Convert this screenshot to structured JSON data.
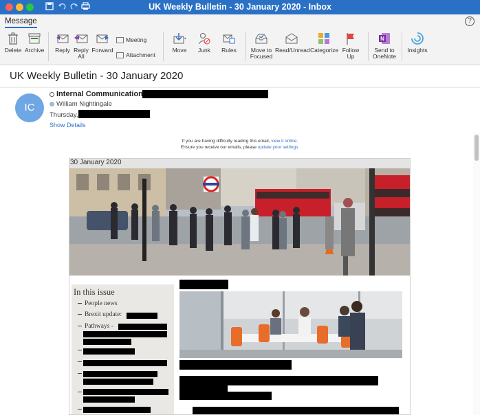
{
  "window": {
    "title": "UK Weekly Bulletin - 30 January 2020 - Inbox"
  },
  "tabs": {
    "message": "Message"
  },
  "ribbon": {
    "delete": "Delete",
    "archive": "Archive",
    "reply": "Reply",
    "reply_all_1": "Reply",
    "reply_all_2": "All",
    "forward": "Forward",
    "meeting": "Meeting",
    "attachment": "Attachment",
    "move": "Move",
    "junk": "Junk",
    "rules": "Rules",
    "move_focused_1": "Move to",
    "move_focused_2": "Focused",
    "read_unread": "Read/Unread",
    "categorize": "Categorize",
    "follow_up_1": "Follow",
    "follow_up_2": "Up",
    "onenote_1": "Send to",
    "onenote_2": "OneNote",
    "insights": "Insights"
  },
  "email": {
    "subject": "UK Weekly Bulletin - 30 January 2020",
    "avatar_initials": "IC",
    "sender": "Internal Communications",
    "recipient": "William Nightingale",
    "date_prefix": "Thursday,",
    "show_details": "Show Details"
  },
  "notice": {
    "line1_prefix": "If you are having difficulty reading this email, ",
    "line1_link": "view it online.",
    "line2_prefix": "Ensure you receive our emails, please ",
    "line2_link": "update your settings."
  },
  "newsletter": {
    "date": "30 January 2020",
    "toc_title": "In this issue",
    "toc_items": [
      "People news",
      "Brexit update:",
      "Pathways -"
    ]
  },
  "colors": {
    "accent": "#2a71c6",
    "titlebar": "#2a71c6",
    "avatar": "#6ea7e3"
  }
}
